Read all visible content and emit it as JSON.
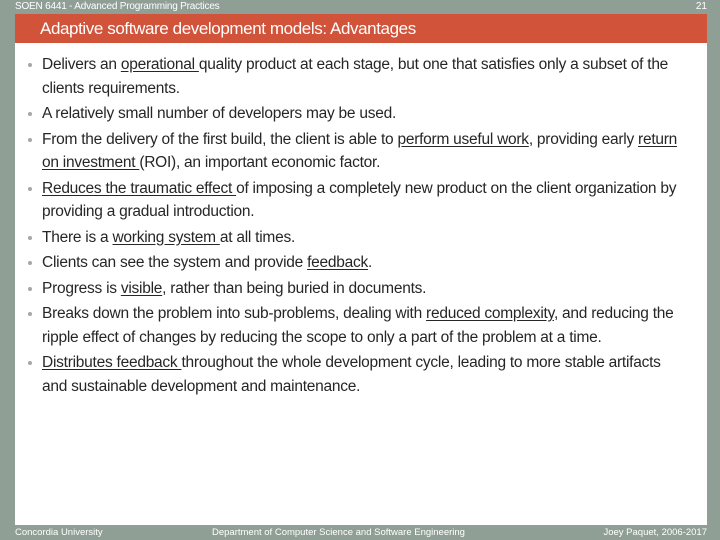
{
  "header": {
    "course": "SOEN 6441 - Advanced Programming Practices",
    "page_number": "21"
  },
  "title": "Adaptive software development models: Advantages",
  "bullets": [
    {
      "segments": [
        {
          "text": "Delivers an ",
          "u": false
        },
        {
          "text": "operational ",
          "u": true
        },
        {
          "text": "quality product at each stage, but one that satisfies only a subset of the clients requirements.",
          "u": false
        }
      ]
    },
    {
      "segments": [
        {
          "text": "A relatively small number of developers may be used.",
          "u": false
        }
      ]
    },
    {
      "segments": [
        {
          "text": "From the delivery of the first build, the client is able to ",
          "u": false
        },
        {
          "text": "perform useful work",
          "u": true
        },
        {
          "text": ", providing early ",
          "u": false
        },
        {
          "text": "return on investment ",
          "u": true
        },
        {
          "text": "(ROI), an important economic factor.",
          "u": false
        }
      ]
    },
    {
      "segments": [
        {
          "text": "Reduces the traumatic effect ",
          "u": true
        },
        {
          "text": "of imposing a completely new product on the client organization by providing a gradual introduction.",
          "u": false
        }
      ]
    },
    {
      "segments": [
        {
          "text": "There is a ",
          "u": false
        },
        {
          "text": "working system ",
          "u": true
        },
        {
          "text": "at all times.",
          "u": false
        }
      ]
    },
    {
      "segments": [
        {
          "text": "Clients can see the system and provide ",
          "u": false
        },
        {
          "text": "feedback",
          "u": true
        },
        {
          "text": ".",
          "u": false
        }
      ]
    },
    {
      "segments": [
        {
          "text": "Progress is ",
          "u": false
        },
        {
          "text": "visible",
          "u": true
        },
        {
          "text": ", rather than being buried in documents.",
          "u": false
        }
      ]
    },
    {
      "segments": [
        {
          "text": "Breaks down the problem into sub-problems, dealing with ",
          "u": false
        },
        {
          "text": "reduced complexity",
          "u": true
        },
        {
          "text": ", and reducing the ripple effect of changes by reducing the scope to only a part of the problem at a time.",
          "u": false
        }
      ]
    },
    {
      "segments": [
        {
          "text": "Distributes feedback ",
          "u": true
        },
        {
          "text": "throughout the whole development cycle, leading to more stable artifacts and sustainable development and maintenance.",
          "u": false
        }
      ]
    }
  ],
  "footer": {
    "left": "Concordia University",
    "center": "Department of Computer Science and Software Engineering",
    "right": "Joey Paquet, 2006-2017"
  },
  "colors": {
    "background": "#8f9f96",
    "title_bar": "#d0533a",
    "content": "#ffffff",
    "text": "#262626"
  }
}
